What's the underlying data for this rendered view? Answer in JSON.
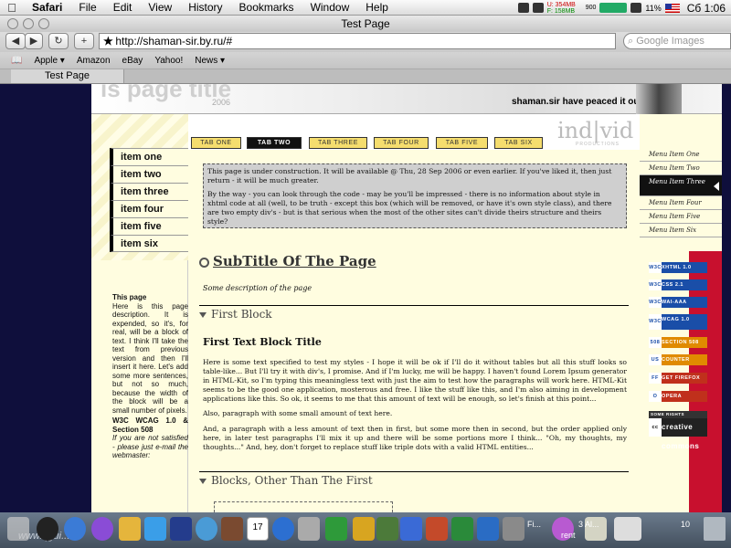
{
  "menubar": {
    "apple": "",
    "items": [
      "Safari",
      "File",
      "Edit",
      "View",
      "History",
      "Bookmarks",
      "Window",
      "Help"
    ],
    "net_up": "U: 354MB",
    "net_down": "F: 158MB",
    "net_count": "900",
    "battery": "11%",
    "clock": "Сб 1:06"
  },
  "window": {
    "title": "Test Page",
    "back": "◀",
    "forward": "▶",
    "reload": "↻",
    "add": "+",
    "url": "http://shaman-sir.by.ru/#",
    "search_placeholder": "Google Images",
    "bookmarks": [
      "Apple ▾",
      "Amazon",
      "eBay",
      "Yahoo!",
      "News ▾"
    ],
    "tab_label": "Test Page"
  },
  "site": {
    "header_ghost": "is page title",
    "year": "2006",
    "slogan": "shaman.sir have peaced it out!",
    "logo": "ind|vid",
    "logo_sub": "PRODUCTIONS",
    "tabs": [
      {
        "label": "TAB ONE",
        "active": false
      },
      {
        "label": "TAB TWO",
        "active": true
      },
      {
        "label": "TAB THREE",
        "active": false
      },
      {
        "label": "TAB FOUR",
        "active": false
      },
      {
        "label": "TAB FIVE",
        "active": false
      },
      {
        "label": "TAB SIX",
        "active": false
      }
    ],
    "left_nav": [
      "item one",
      "item two",
      "item three",
      "item four",
      "item five",
      "item six"
    ],
    "left_desc": {
      "heading": "This page",
      "text": "Here is this page description. It is expended, so it's, for real, will be a block of text. I think I'll take the text from previous version and then I'll insert it here. Let's add some more sentences, but not so much, because the width of the block will be a small number of pixels.",
      "wcag_heading": "W3C WCAG 1.0 & Section 508",
      "wcag_text": "If you are not satisfied - please just e-mail the webmaster:"
    },
    "right_nav": [
      {
        "label": "Menu Item One",
        "active": false
      },
      {
        "label": "Menu Item Two",
        "active": false
      },
      {
        "label": "Menu Item Three",
        "active": true
      },
      {
        "label": "Menu Item Four",
        "active": false
      },
      {
        "label": "Menu Item Five",
        "active": false
      },
      {
        "label": "Menu Item Six",
        "active": false
      }
    ],
    "badges": [
      {
        "logo": "W3C",
        "label": "XHTML 1.0",
        "kind": "w3c"
      },
      {
        "logo": "W3C",
        "label": "CSS 2.1",
        "kind": "w3c"
      },
      {
        "logo": "W3C",
        "label": "WAI-AAA",
        "kind": "w3c"
      },
      {
        "logo": "W3C",
        "label": "WCAG 1.0",
        "kind": "w3c tall"
      },
      {
        "logo": "508",
        "label": "SECTION 508",
        "kind": "d5"
      },
      {
        "logo": "US",
        "label": "COUNTER",
        "kind": "us"
      },
      {
        "logo": "FF",
        "label": "GET FIREFOX",
        "kind": "ff"
      },
      {
        "logo": "O",
        "label": "OPERA",
        "kind": "op"
      },
      {
        "logo": "",
        "label": "SOME RIGHTS RESERVED",
        "kind": "sb"
      },
      {
        "logo": "cc",
        "label": "creative commons",
        "kind": "cc"
      }
    ],
    "notice_p1": "This page is under construction. It will be available @ Thu, 28 Sep 2006 or even earlier. If you've liked it, then just return - it will be much greater.",
    "notice_p2": "By the way - you can look through the code - may be you'll be impressed - there is no information about style in xhtml code at all (well, to be truth - except this box (which will be removed, or have it's own style class), and there are two empty div's - but is that serious when the most of the other sites can't divide theirs structure and theirs style?",
    "subtitle": "SubTitle Of The Page",
    "subtitle_desc": "Some description of the page",
    "block1_head": "First Block",
    "block1_title": "First Text Block Title",
    "block1_p1": "Here is some text specified to test my styles - I hope it will be ok if I'll do it without tables but all this stuff looks so table-like... But I'll try it with div's, I promise. And if I'm lucky, me will be happy. I haven't found Lorem Ipsum generator in HTML-Kit, so I'm typing this meaningless text with just the aim to test how the paragraphs will work here. HTML-Kit seems to be the good one application, mosterous and free. I like the stuff like this, and I'm also aiming in development applications like this. So ok, it seems to me that this amount of text will be enough, so let's finish at this point...",
    "block1_p2": "Also, paragraph with some small amount of text here.",
    "block1_p3": "And, a paragraph with a less amount of text then in first, but some more then in second, but the order applied only here, in later test paragraphs I'll mix it up and there will be some portions more I think... \"Oh, my thoughts, my thoughts...\" And, hey, don't forget to replace stuff like triple dots with a valid HTML entities...",
    "block2_head": "Blocks, Other Than The First"
  },
  "dock": {
    "watermark": "www.qgui...",
    "calendar_day": "17",
    "label1": "Fi...",
    "label2": "3 Al...",
    "label3": "rent",
    "label4": "10",
    "accent": "#c8102e"
  }
}
